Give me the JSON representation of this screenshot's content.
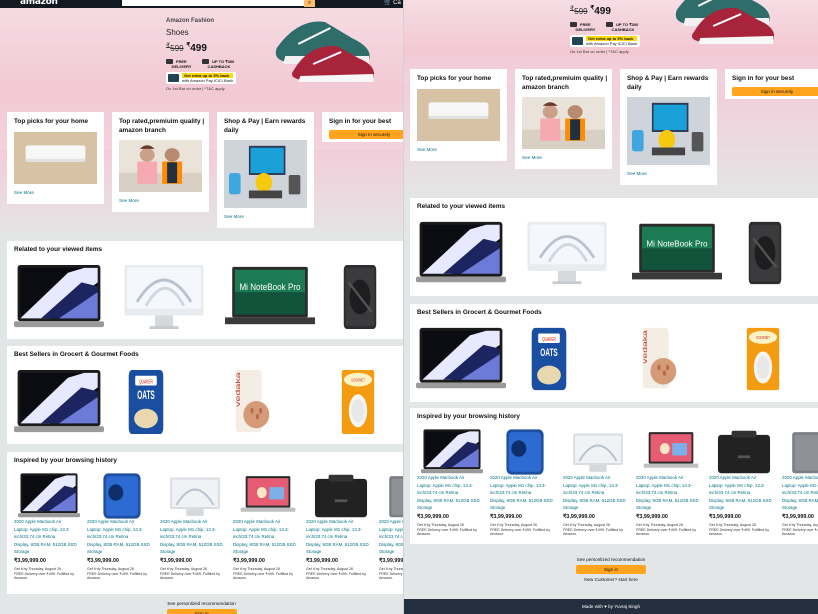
{
  "nav": {
    "logo": "amazon",
    "search_button_icon": "search-icon",
    "cart_label": "Ca"
  },
  "hero": {
    "brand": "Amazon Fashion",
    "title": "Shoes",
    "mrp": "599",
    "price": "499",
    "currency": "₹",
    "perk_delivery": [
      "FREE",
      "DELIVERY"
    ],
    "perk_cashback": [
      "UP TO ₹300",
      "CASHBACK"
    ],
    "offer": [
      "Get extra up to 5% back",
      "with Amazon Pay ICICI Bank"
    ],
    "note": "On 1st Bar on order | *T&C apply"
  },
  "cards": [
    {
      "title": "Top picks for your home",
      "link": "See More"
    },
    {
      "title": "Top rated,premiuim quality | amazon branch",
      "link": "See More"
    },
    {
      "title": "Shop & Pay | Earn rewards daily",
      "link": "See More"
    },
    {
      "title": "Sign in for your best",
      "button": "Sign in securely"
    }
  ],
  "related": {
    "title": "Related to your viewed items",
    "items": [
      "MacBook Pro",
      "iMac",
      "Mi NoteBook Pro",
      "iPad Air"
    ],
    "mi_label": "Mi NoteBook Pro"
  },
  "bestsellers": {
    "title": "Best Sellers in Grocert & Gourmet Foods",
    "items": [
      "MacBook Pro",
      "Quaker Oats",
      "Vedaka",
      "Gourmet Garden"
    ],
    "oats_label": "OATS",
    "vedaka_label": "vedaka"
  },
  "inspired": {
    "title": "Inspired by your browsing history",
    "product": {
      "title_lines": [
        "2020 Apple Macbook Air",
        "Laptop: Apple M1 chip, 13.3-",
        "inch/33.74 cm Retina",
        "Display, 8GB RAM, 512GB SSD",
        "Storage"
      ],
      "price": "₹3,99,999.00",
      "delivery_lines": [
        "Get it by Thursday, August 26",
        "FREE Delivery over ₹499. Fulfilled by",
        "Amazon."
      ]
    }
  },
  "footer": {
    "recommend": "See personlized recommendation",
    "signin": "Sign in",
    "new_customer": "New Customer? start here",
    "made_by": "Made with ♥ by Yuvraj Singh"
  },
  "colors": {
    "nav": "#131921",
    "accent": "#ffa41c",
    "link": "#007185",
    "offer": "#ffd814"
  }
}
